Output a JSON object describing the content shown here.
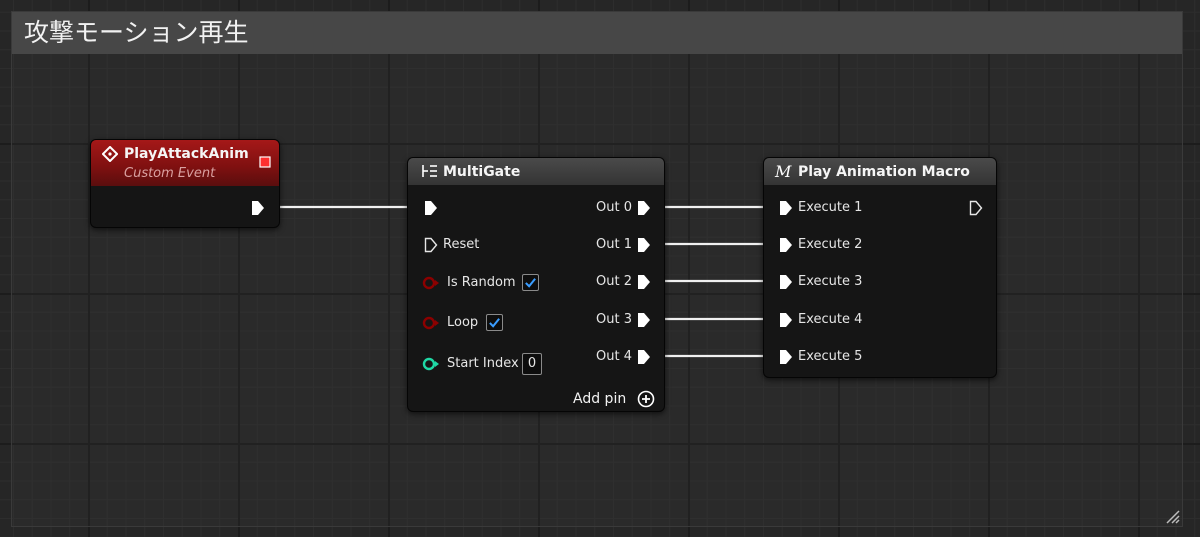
{
  "comment": {
    "title": "攻撃モーション再生"
  },
  "nodes": {
    "event": {
      "title": "PlayAttackAnim",
      "subtitle": "Custom Event",
      "header_color": "#8f1414"
    },
    "multigate": {
      "title": "MultiGate",
      "inputs": [
        "Reset",
        "Is Random",
        "Loop",
        "Start Index"
      ],
      "is_random_checked": true,
      "loop_checked": true,
      "start_index": "0",
      "outputs": [
        "Out 0",
        "Out 1",
        "Out 2",
        "Out 3",
        "Out 4"
      ],
      "add_pin_label": "Add pin"
    },
    "macro": {
      "title": "Play Animation Macro",
      "inputs": [
        "Execute 1",
        "Execute 2",
        "Execute 3",
        "Execute 4",
        "Execute 5"
      ]
    }
  },
  "colors": {
    "exec_pin": "#ffffff",
    "bool_pin": "#8c0000",
    "int_pin": "#1fd8a5",
    "checkbox_check": "#3a9dff",
    "node_header": "#3b3b3b"
  },
  "icons": {
    "event": "diamond-event-icon",
    "multigate": "multigate-icon",
    "macro": "macro-icon",
    "add": "plus-circle-icon",
    "resize": "resize-grip-icon"
  }
}
